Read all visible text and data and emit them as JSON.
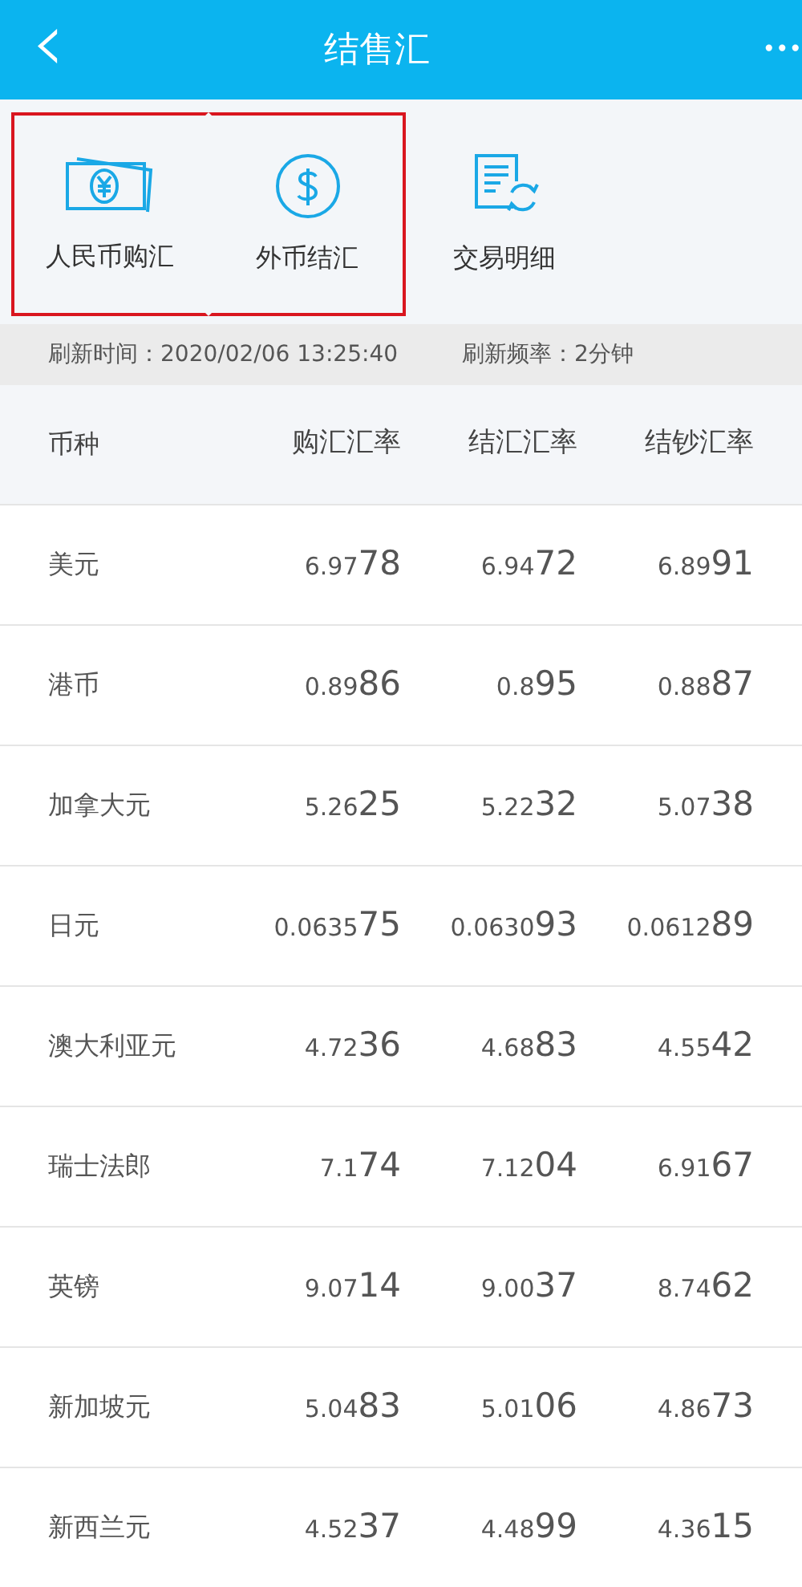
{
  "header": {
    "back": "‹",
    "title": "结售汇",
    "more": "•••"
  },
  "actions": [
    {
      "kind": "cny",
      "label": "人民币购汇",
      "highlighted": true
    },
    {
      "kind": "dollar",
      "label": "外币结汇",
      "highlighted": true
    },
    {
      "kind": "record",
      "label": "交易明细",
      "highlighted": false
    }
  ],
  "refresh": {
    "time": "刷新时间：2020/02/06 13:25:40",
    "frequency": "刷新频率：2分钟"
  },
  "table": {
    "columns": [
      "币种",
      "购汇汇率",
      "结汇汇率",
      "结钞汇率"
    ],
    "rows": [
      {
        "currency": "美元",
        "rates": [
          {
            "head": "6.97",
            "tail": "78"
          },
          {
            "head": "6.94",
            "tail": "72"
          },
          {
            "head": "6.89",
            "tail": "91"
          }
        ]
      },
      {
        "currency": "港币",
        "rates": [
          {
            "head": "0.89",
            "tail": "86"
          },
          {
            "head": "0.8",
            "tail": "95"
          },
          {
            "head": "0.88",
            "tail": "87"
          }
        ]
      },
      {
        "currency": "加拿大元",
        "rates": [
          {
            "head": "5.26",
            "tail": "25"
          },
          {
            "head": "5.22",
            "tail": "32"
          },
          {
            "head": "5.07",
            "tail": "38"
          }
        ]
      },
      {
        "currency": "日元",
        "rates": [
          {
            "head": "0.0635",
            "tail": "75"
          },
          {
            "head": "0.0630",
            "tail": "93"
          },
          {
            "head": "0.0612",
            "tail": "89"
          }
        ]
      },
      {
        "currency": "澳大利亚元",
        "rates": [
          {
            "head": "4.72",
            "tail": "36"
          },
          {
            "head": "4.68",
            "tail": "83"
          },
          {
            "head": "4.55",
            "tail": "42"
          }
        ]
      },
      {
        "currency": "瑞士法郎",
        "rates": [
          {
            "head": "7.1",
            "tail": "74"
          },
          {
            "head": "7.12",
            "tail": "04"
          },
          {
            "head": "6.91",
            "tail": "67"
          }
        ]
      },
      {
        "currency": "英镑",
        "rates": [
          {
            "head": "9.07",
            "tail": "14"
          },
          {
            "head": "9.00",
            "tail": "37"
          },
          {
            "head": "8.74",
            "tail": "62"
          }
        ]
      },
      {
        "currency": "新加坡元",
        "rates": [
          {
            "head": "5.04",
            "tail": "83"
          },
          {
            "head": "5.01",
            "tail": "06"
          },
          {
            "head": "4.86",
            "tail": "73"
          }
        ]
      },
      {
        "currency": "新西兰元",
        "rates": [
          {
            "head": "4.52",
            "tail": "37"
          },
          {
            "head": "4.48",
            "tail": "99"
          },
          {
            "head": "4.36",
            "tail": "15"
          }
        ]
      }
    ]
  }
}
